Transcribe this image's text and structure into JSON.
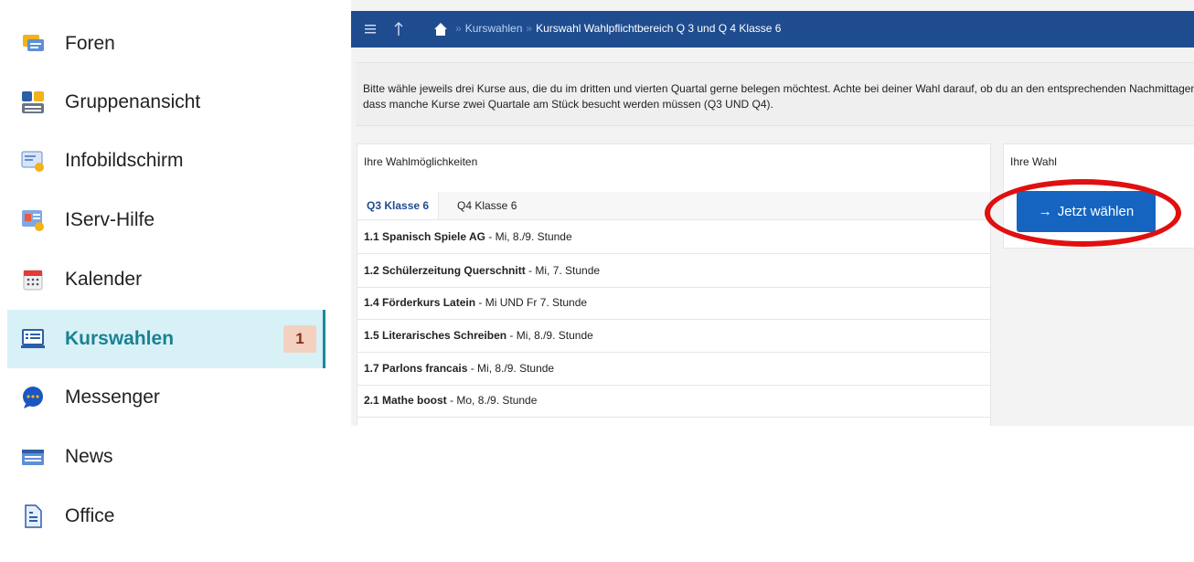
{
  "sidebar": {
    "items": [
      {
        "label": "Foren",
        "icon": "forum-icon"
      },
      {
        "label": "Gruppenansicht",
        "icon": "groups-icon"
      },
      {
        "label": "Infobildschirm",
        "icon": "info-screen-icon"
      },
      {
        "label": "IServ-Hilfe",
        "icon": "help-icon"
      },
      {
        "label": "Kalender",
        "icon": "calendar-icon"
      },
      {
        "label": "Kurswahlen",
        "icon": "course-selection-icon",
        "badge": "1",
        "active": true
      },
      {
        "label": "Messenger",
        "icon": "messenger-icon"
      },
      {
        "label": "News",
        "icon": "news-icon"
      },
      {
        "label": "Office",
        "icon": "office-icon"
      }
    ]
  },
  "breadcrumb": {
    "parent": "Kurswahlen",
    "current": "Kurswahl Wahlpflichtbereich Q 3 und Q 4 Klasse 6"
  },
  "intro": {
    "text": "Bitte wähle jeweils drei Kurse aus, die du im dritten und vierten Quartal gerne belegen möchtest. Achte bei deiner Wahl darauf, ob du an den entsprechenden Nachmittagen Zeit hast und dass manche Kurse zwei Quartale am Stück besucht werden müssen (Q3 UND Q4)."
  },
  "options_panel": {
    "title": "Ihre Wahlmöglichkeiten",
    "tabs": [
      "Q3 Klasse 6",
      "Q4 Klasse 6"
    ],
    "courses": [
      {
        "name": "1.1 Spanisch Spiele AG",
        "detail": " - Mi, 8./9. Stunde"
      },
      {
        "name": "1.2 Schülerzeitung Querschnitt",
        "detail": " - Mi, 7. Stunde"
      },
      {
        "name": "1.4 Förderkurs Latein",
        "detail": " - Mi UND Fr 7. Stunde"
      },
      {
        "name": "1.5 Literarisches Schreiben",
        "detail": " - Mi, 8./9. Stunde"
      },
      {
        "name": "1.7 Parlons francais",
        "detail": " - Mi, 8./9. Stunde"
      },
      {
        "name": "2.1 Mathe boost",
        "detail": " - Mo, 8./9. Stunde"
      }
    ]
  },
  "choice_panel": {
    "title": "Ihre Wahl",
    "button_label": "Jetzt wählen",
    "button_arrow": "→"
  },
  "colors": {
    "topbar": "#1f4c8f",
    "accent": "#1565c0",
    "highlight_circle": "#e01010",
    "active_nav_bg": "#d8f1f6"
  }
}
